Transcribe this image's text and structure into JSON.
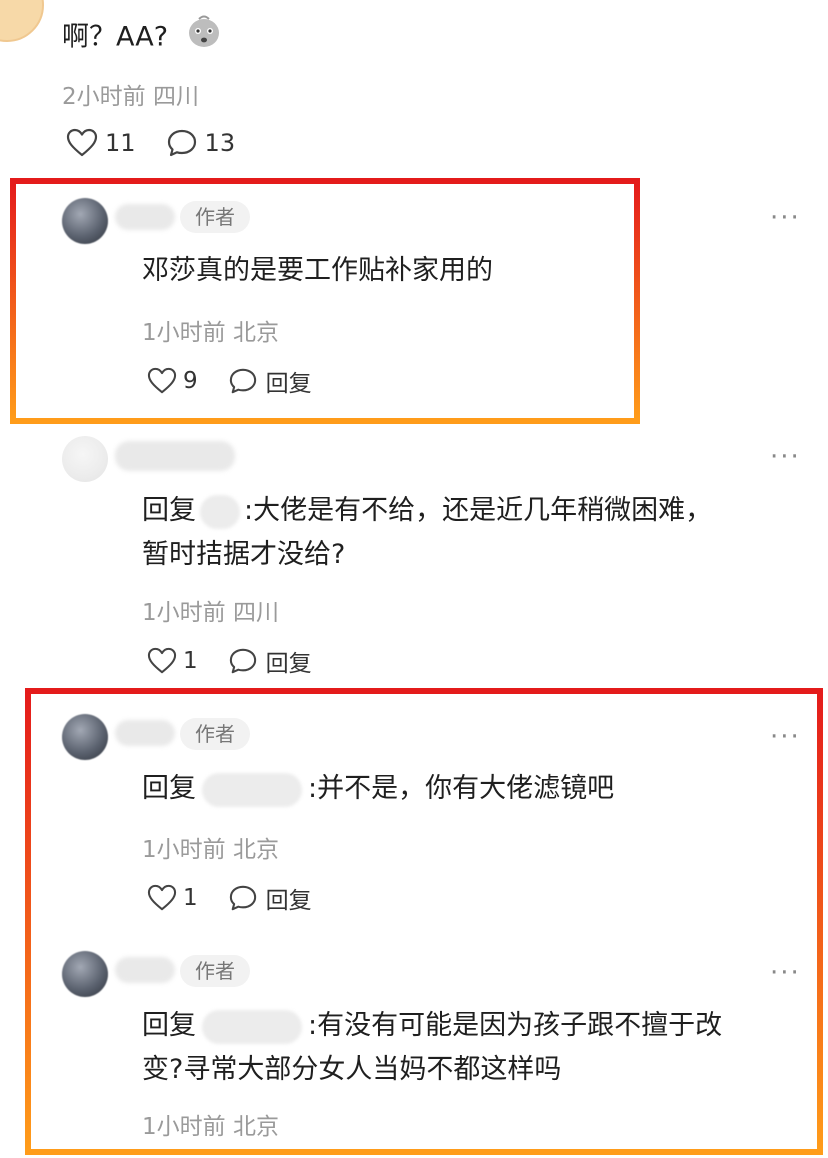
{
  "top_comment": {
    "text": "啊？AA?",
    "emoji_icon": "cute-face-emoji-icon",
    "time": "2小时前",
    "location": "四川",
    "likes": "11",
    "replies": "13"
  },
  "comments": [
    {
      "author_tag": "作者",
      "text": "邓莎真的是要工作贴补家用的",
      "time": "1小时前",
      "location": "北京",
      "likes": "9",
      "reply_label": "回复"
    },
    {
      "reply_prefix": "回复",
      "text": ":大佬是有不给，还是近几年稍微困难，",
      "text2": "暂时拮据才没给?",
      "time": "1小时前",
      "location": "四川",
      "likes": "1",
      "reply_label": "回复"
    },
    {
      "author_tag": "作者",
      "reply_prefix": "回复",
      "text": ":并不是，你有大佬滤镜吧",
      "time": "1小时前",
      "location": "北京",
      "likes": "1",
      "reply_label": "回复"
    },
    {
      "author_tag": "作者",
      "reply_prefix": "回复",
      "text": ":有没有可能是因为孩子跟不擅于改",
      "text2": "变?寻常大部分女人当妈不都这样吗",
      "time": "1小时前",
      "location": "北京"
    }
  ],
  "more_label": "···",
  "colors": {
    "highlight_top": "#e41b1b",
    "highlight_bottom": "#ff9c1a"
  }
}
